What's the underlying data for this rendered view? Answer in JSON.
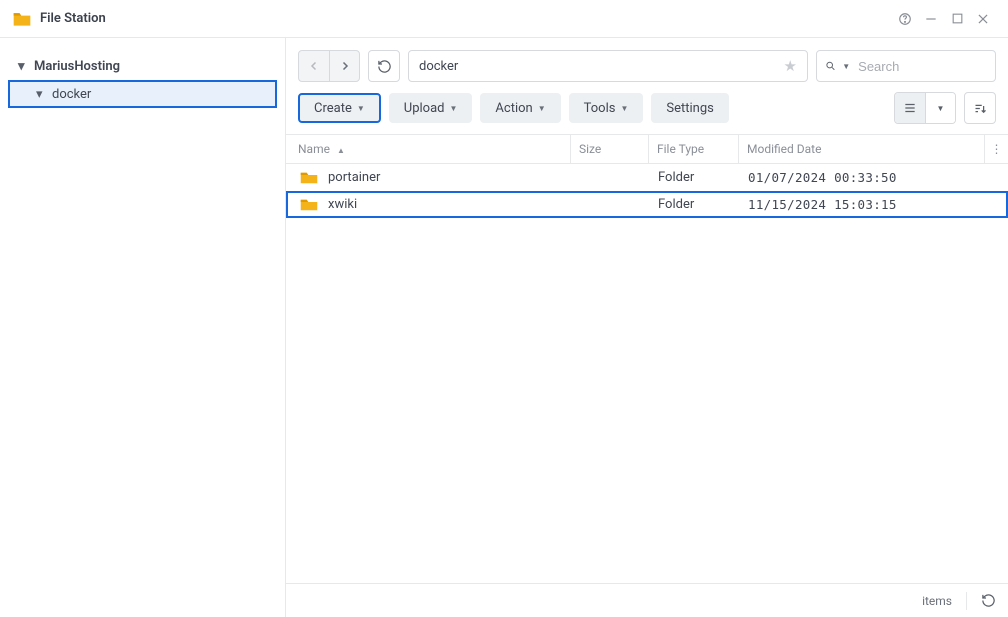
{
  "app": {
    "title": "File Station"
  },
  "sidebar": {
    "root": "MariusHosting",
    "child": "docker"
  },
  "path": "docker",
  "search": {
    "placeholder": "Search"
  },
  "toolbar": {
    "create": "Create",
    "upload": "Upload",
    "action": "Action",
    "tools": "Tools",
    "settings": "Settings"
  },
  "columns": {
    "name": "Name",
    "size": "Size",
    "type": "File Type",
    "date": "Modified Date"
  },
  "rows": [
    {
      "name": "portainer",
      "type": "Folder",
      "date": "01/07/2024 00:33:50",
      "highlight": false
    },
    {
      "name": "xwiki",
      "type": "Folder",
      "date": "11/15/2024 15:03:15",
      "highlight": true
    }
  ],
  "status": {
    "items": "items"
  }
}
